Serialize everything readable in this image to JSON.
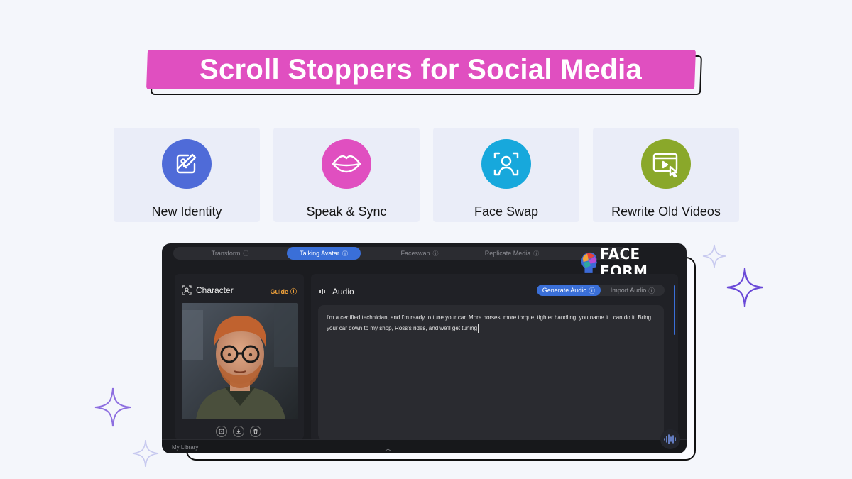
{
  "banner": {
    "title": "Scroll Stoppers for Social Media"
  },
  "features": [
    {
      "label": "New Identity",
      "icon": "image-edit-icon",
      "color": "#4f6bd8"
    },
    {
      "label": "Speak & Sync",
      "icon": "lips-icon",
      "color": "#e04fc0"
    },
    {
      "label": "Face Swap",
      "icon": "face-scan-icon",
      "color": "#17a8dc"
    },
    {
      "label": "Rewrite Old Videos",
      "icon": "video-click-icon",
      "color": "#8aa82a"
    }
  ],
  "app": {
    "tabs": [
      {
        "label": "Transform",
        "active": false
      },
      {
        "label": "Talking Avatar",
        "active": true
      },
      {
        "label": "Faceswap",
        "active": false
      },
      {
        "label": "Replicate Media",
        "active": false
      }
    ],
    "logo_text": "FACE FORM",
    "character": {
      "title": "Character",
      "guide_label": "Guide"
    },
    "audio": {
      "title": "Audio",
      "generate_label": "Generate Audio",
      "import_label": "Import Audio",
      "script": "I'm a certified technician, and I'm ready to tune your car.  More horses, more torque, tighter handling, you name it I can do it.  Bring your car down to my shop, Ross's rides, and we'll get tuning"
    },
    "library_label": "My Library",
    "accent_color": "#3a6fd8"
  }
}
